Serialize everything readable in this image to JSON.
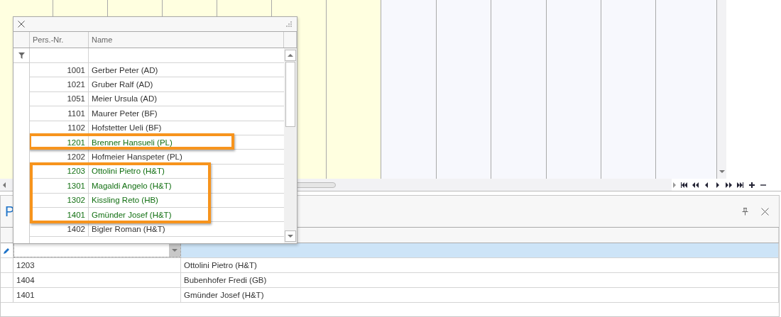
{
  "lookup_popup": {
    "columns": [
      "Pers.-Nr.",
      "Name"
    ],
    "rows": [
      {
        "number": "1001",
        "name": "Gerber Peter (AD)",
        "highlighted": false,
        "boxed": false
      },
      {
        "number": "1021",
        "name": "Gruber Ralf (AD)",
        "highlighted": false,
        "boxed": false
      },
      {
        "number": "1051",
        "name": "Meier Ursula (AD)",
        "highlighted": false,
        "boxed": false
      },
      {
        "number": "1101",
        "name": "Maurer Peter (BF)",
        "highlighted": false,
        "boxed": false
      },
      {
        "number": "1102",
        "name": "Hofstetter Ueli (BF)",
        "highlighted": false,
        "boxed": false
      },
      {
        "number": "1201",
        "name": "Brenner Hansueli (PL)",
        "highlighted": true,
        "boxed": true
      },
      {
        "number": "1202",
        "name": "Hofmeier Hanspeter (PL)",
        "highlighted": false,
        "boxed": false
      },
      {
        "number": "1203",
        "name": "Ottolini Pietro (H&T)",
        "highlighted": true,
        "boxed": true
      },
      {
        "number": "1301",
        "name": "Magaldi Angelo (H&T)",
        "highlighted": true,
        "boxed": true
      },
      {
        "number": "1302",
        "name": "Kissling Reto (HB)",
        "highlighted": true,
        "boxed": true
      },
      {
        "number": "1401",
        "name": "Gmünder Josef (H&T)",
        "highlighted": true,
        "boxed": true
      },
      {
        "number": "1402",
        "name": "Bigler Roman (H&T)",
        "highlighted": false,
        "boxed": false
      }
    ]
  },
  "panel": {
    "title": "P",
    "rows": [
      {
        "number": "1203",
        "name": "Ottolini Pietro (H&T)"
      },
      {
        "number": "1404",
        "name": "Bubenhofer Fredi (GB)"
      },
      {
        "number": "1401",
        "name": "Gmünder Josef (H&T)"
      }
    ]
  }
}
